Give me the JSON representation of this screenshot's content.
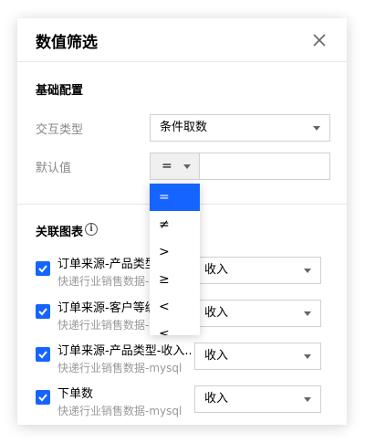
{
  "dialog": {
    "title": "数值筛选",
    "close_icon": "close-icon"
  },
  "basic": {
    "section_title": "基础配置",
    "interaction_type_label": "交互类型",
    "interaction_type_value": "条件取数",
    "default_value_label": "默认值",
    "operator_value": "=",
    "default_value_input": ""
  },
  "operator_dropdown": {
    "options": [
      "=",
      "≠",
      ">",
      "≥",
      "<",
      "≤"
    ],
    "selected": "="
  },
  "linked": {
    "section_title": "关联图表",
    "info_icon": "info-icon",
    "items": [
      {
        "name": "订单来源-产品类型",
        "source": "快递行业销售数据-",
        "checked": true,
        "field": "收入"
      },
      {
        "name": "订单来源-客户等级",
        "source": "快递行业销售数据-",
        "checked": true,
        "field": "收入"
      },
      {
        "name": "订单来源-产品类型-收入...",
        "source": "快递行业销售数据-mysql",
        "checked": true,
        "field": "收入"
      },
      {
        "name": "下单数",
        "source": "快递行业销售数据-mysql",
        "checked": true,
        "field": "收入"
      }
    ]
  },
  "colors": {
    "accent": "#1664ff"
  }
}
